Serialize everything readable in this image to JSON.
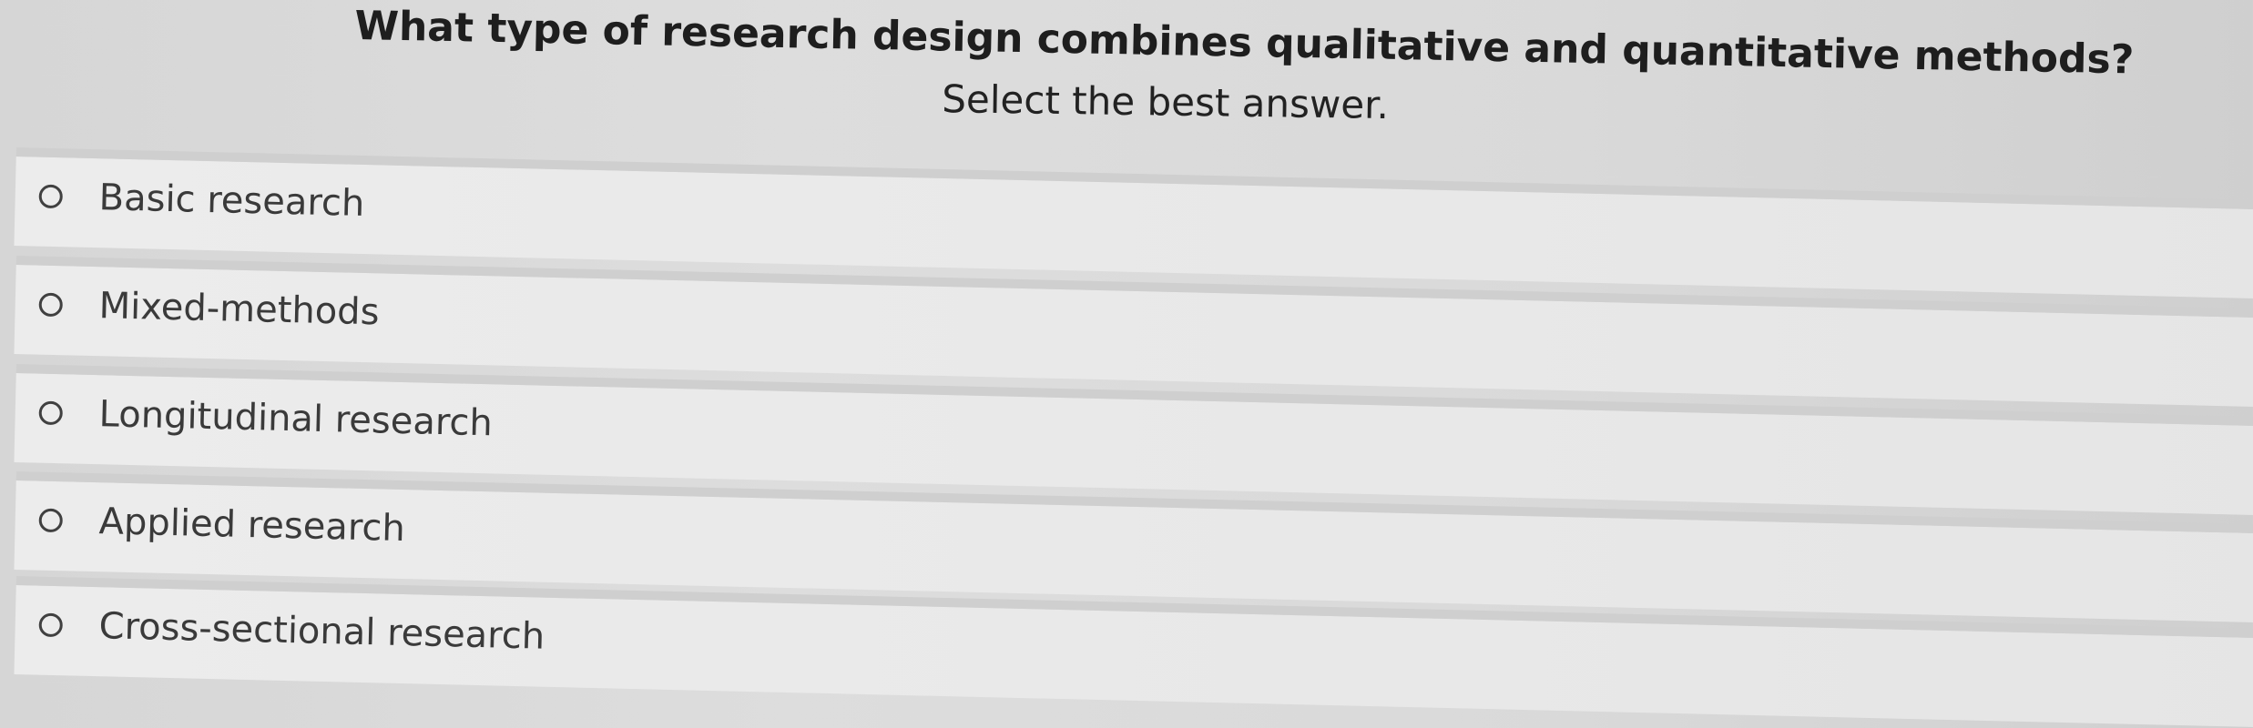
{
  "question": {
    "title": "What type of research design combines qualitative and quantitative methods?",
    "instruction": "Select the best answer."
  },
  "options": [
    {
      "label": "Basic research",
      "selected": false
    },
    {
      "label": "Mixed-methods",
      "selected": false
    },
    {
      "label": "Longitudinal research",
      "selected": false
    },
    {
      "label": "Applied research",
      "selected": false
    },
    {
      "label": "Cross-sectional research",
      "selected": false
    }
  ],
  "icons": {
    "radio": "radio-button-icon"
  }
}
